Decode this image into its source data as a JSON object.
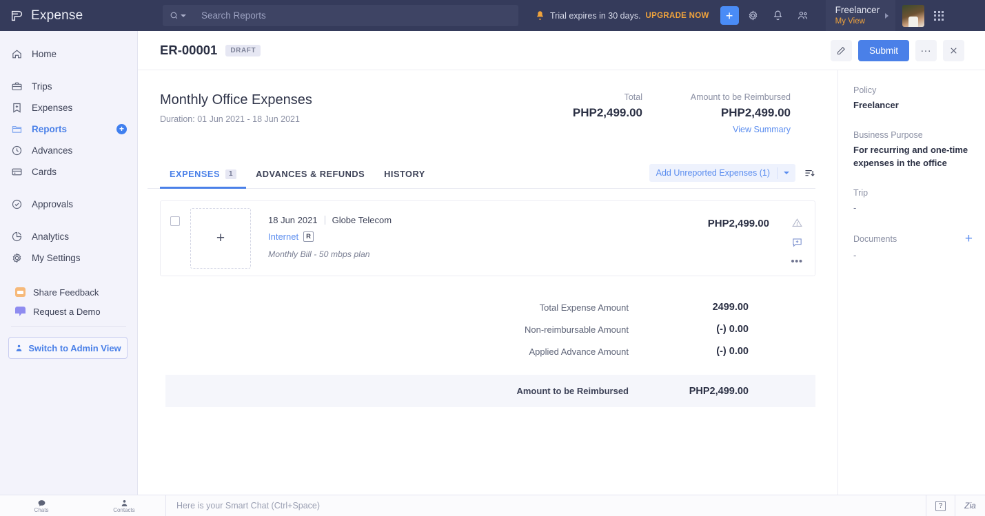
{
  "topbar": {
    "brand": "Expense",
    "search": {
      "placeholder": "Search Reports",
      "value": ""
    },
    "trial_text": "Trial expires in 30 days.",
    "trial_cta": "UPGRADE NOW",
    "add_label": "+",
    "org_name": "Freelancer",
    "org_sub": "My View"
  },
  "sidebar": {
    "items": [
      {
        "label": "Home",
        "icon": "home-icon"
      },
      {
        "label": "Trips",
        "icon": "briefcase-icon"
      },
      {
        "label": "Expenses",
        "icon": "expense-icon"
      },
      {
        "label": "Reports",
        "icon": "folder-icon",
        "active": true,
        "add": "+"
      },
      {
        "label": "Advances",
        "icon": "clock-icon"
      },
      {
        "label": "Cards",
        "icon": "card-icon"
      },
      {
        "label": "Approvals",
        "icon": "check-circle-icon"
      },
      {
        "label": "Analytics",
        "icon": "pie-chart-icon"
      },
      {
        "label": "My Settings",
        "icon": "gear-icon"
      }
    ],
    "feedback": "Share Feedback",
    "demo": "Request a Demo",
    "admin_button": "Switch to Admin View"
  },
  "header": {
    "report_id": "ER-00001",
    "status": "DRAFT",
    "edit_label": "Edit",
    "submit_label": "Submit",
    "more_label": "...",
    "close_label": "×"
  },
  "report": {
    "title": "Monthly Office Expenses",
    "duration": "Duration: 01 Jun 2021 - 18 Jun 2021",
    "total_label": "Total",
    "total_value": "PHP2,499.00",
    "reimburse_label": "Amount to be Reimbursed",
    "reimburse_value": "PHP2,499.00",
    "view_summary": "View Summary"
  },
  "tabs": [
    {
      "label": "EXPENSES",
      "count": "1",
      "active": true
    },
    {
      "label": "ADVANCES & REFUNDS",
      "active": false
    },
    {
      "label": "HISTORY",
      "active": false
    }
  ],
  "tab_actions": {
    "add_unreported": "Add Unreported Expenses (1)",
    "sort_label": "Sort"
  },
  "expenses": [
    {
      "date": "18 Jun 2021",
      "merchant": "Globe Telecom",
      "category": "Internet",
      "flag": "R",
      "description": "Monthly Bill - 50 mbps plan",
      "amount": "PHP2,499.00",
      "receipt_placeholder": "+"
    }
  ],
  "totals": {
    "rows": [
      {
        "label": "Total Expense Amount",
        "value": "2499.00"
      },
      {
        "label": "Non-reimbursable Amount",
        "value": "(-) 0.00"
      },
      {
        "label": "Applied Advance Amount",
        "value": "(-) 0.00"
      }
    ],
    "grand_label": "Amount to be Reimbursed",
    "grand_value": "PHP2,499.00"
  },
  "details": {
    "policy_label": "Policy",
    "policy_value": "Freelancer",
    "purpose_label": "Business Purpose",
    "purpose_value": "For recurring and one-time expenses in the office",
    "trip_label": "Trip",
    "trip_value": "-",
    "documents_label": "Documents",
    "documents_value": "-",
    "documents_add": "+"
  },
  "bottombar": {
    "chats": "Chats",
    "contacts": "Contacts",
    "chat_placeholder": "Here is your Smart Chat (Ctrl+Space)",
    "help": "?",
    "zia": "Zia"
  },
  "colors": {
    "accent": "#4a80e8",
    "topbar": "#353b5b",
    "sidebar": "#f3f3fb",
    "warning": "#f0a33c"
  }
}
